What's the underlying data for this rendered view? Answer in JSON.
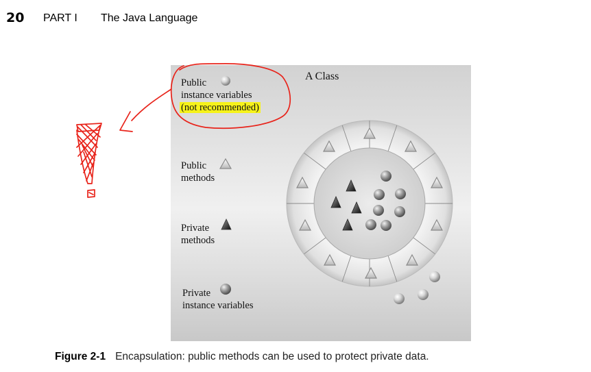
{
  "header": {
    "page_number": "20",
    "part": "PART I",
    "book_title": "The Java Language"
  },
  "figure": {
    "class_title": "A Class",
    "legend": {
      "public_instance_variables": [
        "Public",
        "instance variables",
        "(not recommended)"
      ],
      "public_methods": [
        "Public",
        "methods"
      ],
      "private_methods": [
        "Private",
        "methods"
      ],
      "private_instance_variables": [
        "Private",
        "instance variables"
      ]
    },
    "icons": {
      "public_variable": "light-sphere-icon",
      "public_method": "outlined-triangle-icon",
      "private_method": "dark-triangle-icon",
      "private_variable": "dark-sphere-icon"
    },
    "colors": {
      "highlight": "#f6f21a",
      "annotation_ink": "#e8231a"
    }
  },
  "caption": {
    "label": "Figure 2-1",
    "text": "Encapsulation: public methods can be used to protect private data."
  }
}
